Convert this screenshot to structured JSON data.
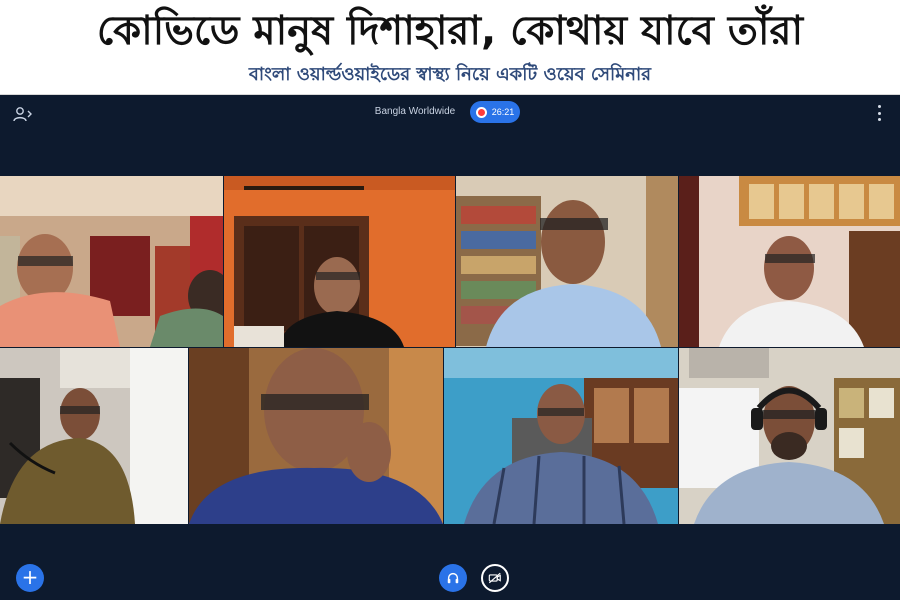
{
  "banner": {
    "headline": "কোভিডে মানুষ দিশাহারা, কোথায় যাবে তাঁরা",
    "subline": "বাংলা ওয়ার্ল্ডওয়াইডের স্বাস্থ্য নিয়ে একটি ওয়েব সেমিনার"
  },
  "meeting": {
    "title": "Bangla Worldwide",
    "timer": "26:21",
    "icons": {
      "participants": "participants-icon",
      "record": "record-icon",
      "more": "more-vertical-icon",
      "add": "plus-icon",
      "audio": "headphones-icon",
      "video": "video-off-icon"
    },
    "colors": {
      "background": "#0d1a2e",
      "accent": "#2a73e8",
      "record": "#ff3b3b"
    },
    "add_label": "+"
  }
}
